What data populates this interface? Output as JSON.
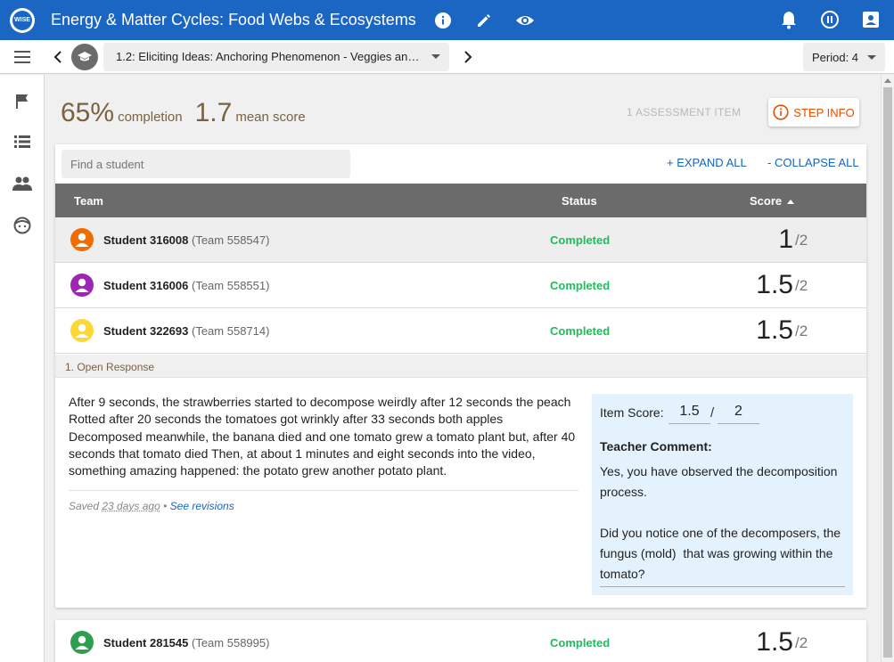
{
  "app": {
    "logo_text": "WISE",
    "title": "Energy & Matter Cycles: Food Webs & Ecosystems",
    "icons_left": [
      "info-icon",
      "edit-icon",
      "eye-icon"
    ],
    "icons_right": [
      "bell-icon",
      "pause-icon",
      "account-icon"
    ]
  },
  "subbar": {
    "step_label": "1.2: Eliciting Ideas: Anchoring Phenomenon - Veggies and ...",
    "period_label": "Period: 4"
  },
  "leftnav": [
    "flag-icon",
    "list-icon",
    "people-icon",
    "face-icon"
  ],
  "stats": {
    "completion_value": "65",
    "completion_unit": "%",
    "completion_label": "completion",
    "mean_value": "1.7",
    "mean_label": "mean score",
    "assessment_count": "1 ASSESSMENT ITEM",
    "step_info_label": "STEP INFO"
  },
  "toolbar": {
    "search_placeholder": "Find a student",
    "expand_all": "+ EXPAND ALL",
    "collapse_all": "- COLLAPSE ALL"
  },
  "table": {
    "col_team": "Team",
    "col_status": "Status",
    "col_score": "Score"
  },
  "rows": [
    {
      "name": "Student 316008",
      "team": "(Team 558547)",
      "status": "Completed",
      "score": "1",
      "max": "/2",
      "avatar_color": "#ef6c00"
    },
    {
      "name": "Student 316006",
      "team": "(Team 558551)",
      "status": "Completed",
      "score": "1.5",
      "max": "/2",
      "avatar_color": "#9c27b0"
    },
    {
      "name": "Student 322693",
      "team": "(Team 558714)",
      "status": "Completed",
      "score": "1.5",
      "max": "/2",
      "avatar_color": "#fdd835"
    },
    {
      "name": "Student 281545",
      "team": "(Team 558995)",
      "status": "Completed",
      "score": "1.5",
      "max": "/2",
      "avatar_color": "#2e9e4f"
    }
  ],
  "response": {
    "header": "1. Open Response",
    "text": "After 9 seconds, the strawberries started to decompose weirdly after 12 seconds the peach Rotted after 20 seconds the tomatoes got wrinkly after 33 seconds both apples Decomposed meanwhile, the banana died and one tomato grew a tomato plant but, after 40 seconds that tomato died Then, at about 1 minutes and eight seconds into the video, something amazing happened: the potato grew another potato plant.",
    "saved_prefix": "Saved",
    "saved_ago": "23 days ago",
    "separator": "•",
    "see_revisions": "See revisions"
  },
  "grading": {
    "item_score_label": "Item Score:",
    "score_value": "1.5",
    "slash": "/",
    "max_value": "2",
    "comment_label": "Teacher Comment:",
    "comment_text": "Yes, you have observed the decomposition process.\n\nDid you notice one of the decomposers, the fungus (mold)  that was growing within the tomato?"
  },
  "colors": {
    "primary": "#1c66c3",
    "completed": "#1ebc5a",
    "accent": "#e65100",
    "stats_text": "#7a6240",
    "grade_panel": "#e3f2fd"
  }
}
